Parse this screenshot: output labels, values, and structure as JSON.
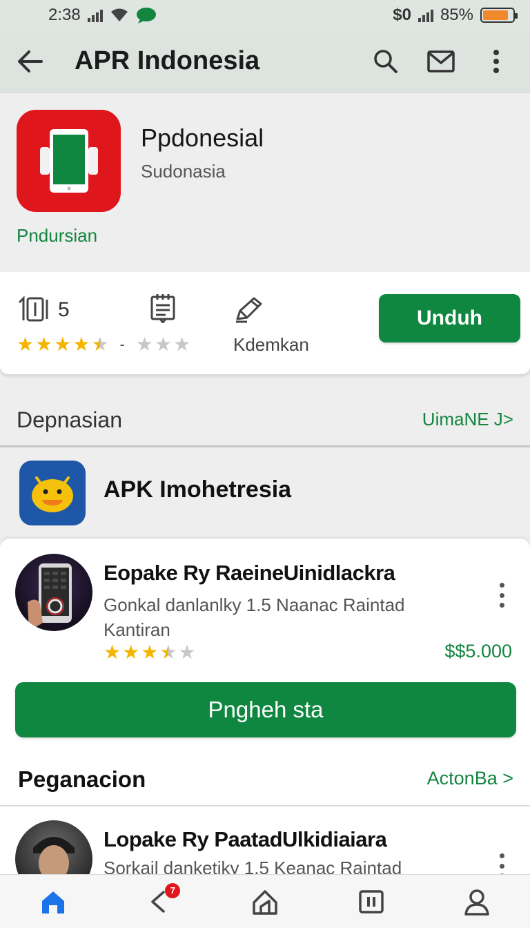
{
  "status_bar": {
    "time": "2:38",
    "network_text": "$0",
    "battery_text": "85%",
    "battery_level": 0.85,
    "battery_color": "#f08a2c"
  },
  "app_bar": {
    "title": "APR Indonesia",
    "icons": [
      "back-arrow-icon",
      "search-icon",
      "mail-icon",
      "more-vert-icon"
    ]
  },
  "app": {
    "name": "Ppdonesial",
    "developer": "Sudonasia",
    "category": "Pndursian",
    "icon_color": "#e0161d"
  },
  "stats": {
    "rating_value": "5",
    "rating_stars": 4.5,
    "dash": "-",
    "secondary_stars": 3,
    "action_label": "Kdemkan",
    "install_label": "Unduh"
  },
  "section_1": {
    "title": "Depnasian",
    "link": "UimaNE J>"
  },
  "apk_row": {
    "title": "APK Imohetresia",
    "icon_color": "#1e57a8"
  },
  "featured": {
    "title": "Eopake Ry RaeineUinidlackra",
    "description": "Gonkal danlanlky 1.5 Naanac Raintad Kantiran",
    "stars": 3.5,
    "price": "$$5.000",
    "button_label": "Pngheh sta"
  },
  "section_2": {
    "title": "Peganacion",
    "link": "ActonBa >"
  },
  "item_2": {
    "title": "Lopake Ry PaatadUlkidiaiara",
    "description": "Sorkail danketiky 1.5 Keanac Raintad"
  },
  "bottom_nav": {
    "badge_count": "7",
    "items": [
      "home-icon",
      "back-icon",
      "store-icon",
      "library-icon",
      "profile-icon"
    ]
  },
  "colors": {
    "accent_green": "#0f8740",
    "link_green": "#13853f",
    "star": "#f4b400"
  }
}
